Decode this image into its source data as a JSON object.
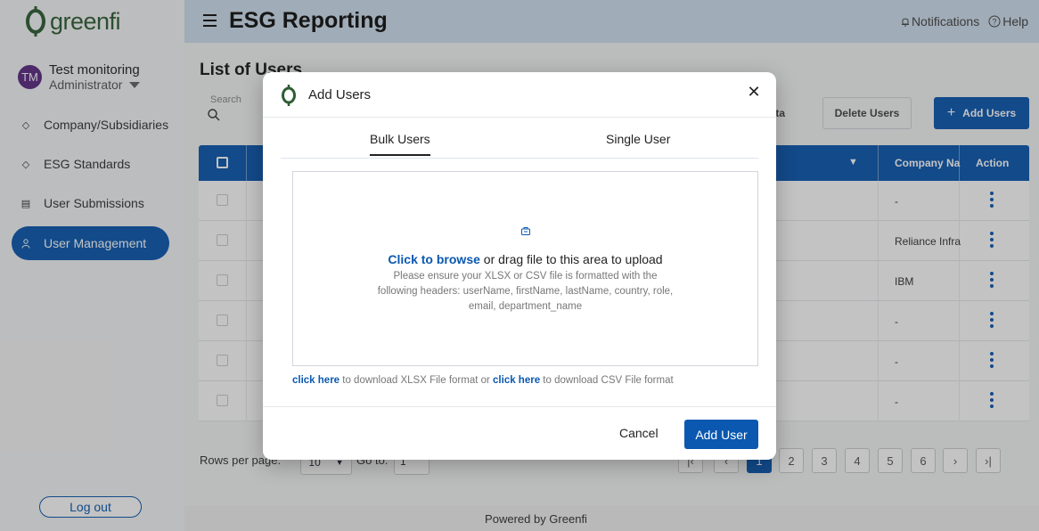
{
  "brand": {
    "name": "greenfi",
    "accent": "#0a58b0",
    "logo_color": "#2f5d34"
  },
  "user": {
    "initials": "TM",
    "name": "Test monitoring",
    "role": "Administrator"
  },
  "sidebar": {
    "items": [
      {
        "label": "Company/Subsidiaries",
        "icon": "diamond-icon"
      },
      {
        "label": "ESG Standards",
        "icon": "diamond-icon"
      },
      {
        "label": "User Submissions",
        "icon": "document-icon"
      },
      {
        "label": "User Management",
        "icon": "person-icon",
        "active": true
      }
    ],
    "logout": "Log out"
  },
  "topbar": {
    "title": "ESG Reporting",
    "notifications": "Notifications",
    "help": "Help"
  },
  "main": {
    "page_title": "List of Users",
    "search_label": "Search",
    "data_btn": "Data",
    "delete_btn": "Delete Users",
    "add_btn": "Add Users",
    "columns": {
      "company": "Company Na",
      "action": "Action"
    },
    "rows": [
      {
        "company": "-"
      },
      {
        "company": "Reliance Infra"
      },
      {
        "company": "IBM"
      },
      {
        "company": "-"
      },
      {
        "company": "-"
      },
      {
        "company": "-"
      }
    ],
    "rows_per_page_label": "Rows per page:",
    "rows_per_page_value": "10",
    "goto_label": "Go to:",
    "goto_value": "1",
    "pages": [
      "1",
      "2",
      "3",
      "4",
      "5",
      "6"
    ],
    "current_page": "1"
  },
  "footer": {
    "text": "Powered by Greenfi"
  },
  "modal": {
    "title": "Add Users",
    "tabs": [
      "Bulk Users",
      "Single User"
    ],
    "active_tab": "Bulk Users",
    "dropzone_link": "Click to browse",
    "dropzone_text": " or drag file to this area to upload",
    "dropzone_note": "Please ensure your XLSX or CSV file is formatted with the following headers: userName, firstName, lastName, country, role, email, department_name",
    "dl_link1": "click here",
    "dl_text1": " to download XLSX File format or ",
    "dl_link2": "click here",
    "dl_text2": " to download CSV File format",
    "cancel": "Cancel",
    "submit": "Add User"
  }
}
